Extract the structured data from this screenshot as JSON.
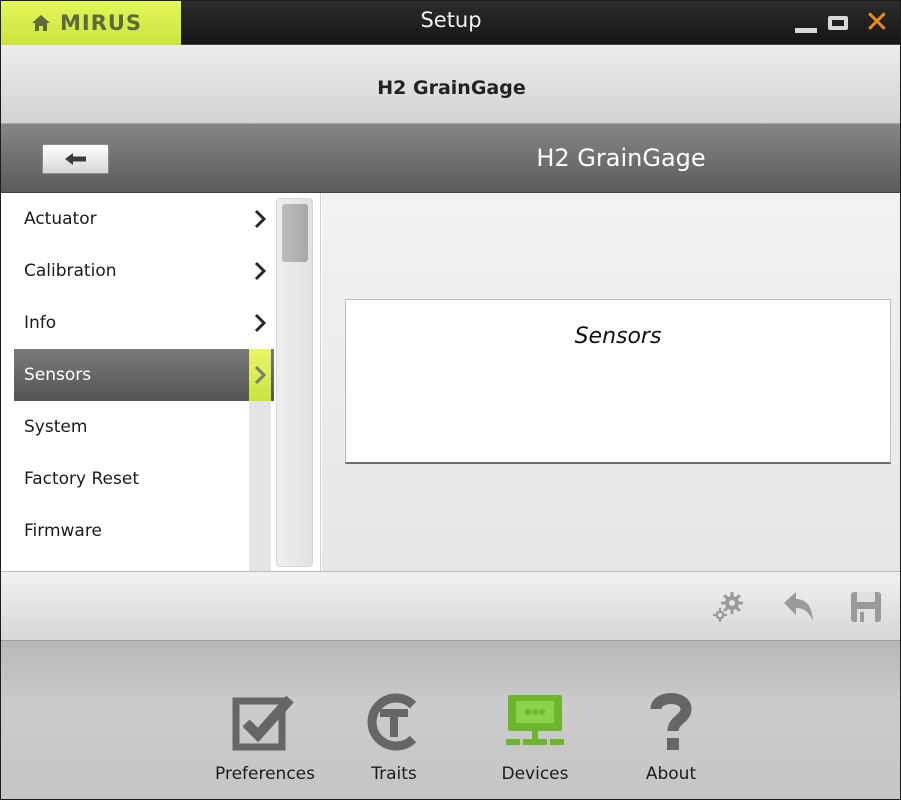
{
  "window": {
    "home_label": "MIRUS",
    "title": "Setup",
    "close_glyph": "✕",
    "accent_color": "#d4ea48",
    "close_color": "#f08a1c"
  },
  "subheader": {
    "title": "H2 GrainGage"
  },
  "pageheader": {
    "title": "H2 GrainGage",
    "back_icon": "back-arrow-icon"
  },
  "sidebar": {
    "items": [
      {
        "label": "Actuator",
        "has_chevron": true,
        "selected": false
      },
      {
        "label": "Calibration",
        "has_chevron": true,
        "selected": false
      },
      {
        "label": "Info",
        "has_chevron": true,
        "selected": false
      },
      {
        "label": "Sensors",
        "has_chevron": true,
        "selected": true
      },
      {
        "label": "System",
        "has_chevron": false,
        "selected": false
      },
      {
        "label": "Factory Reset",
        "has_chevron": false,
        "selected": false
      },
      {
        "label": "Firmware",
        "has_chevron": false,
        "selected": false
      }
    ]
  },
  "content": {
    "card_title": "Sensors"
  },
  "actionbar": {
    "icons": [
      "settings-gears-icon",
      "undo-arrow-icon",
      "save-disk-icon"
    ]
  },
  "bottomnav": {
    "items": [
      {
        "label": "Preferences",
        "icon": "checkbox-icon",
        "active": false
      },
      {
        "label": "Traits",
        "icon": "traits-t-icon",
        "active": false
      },
      {
        "label": "Devices",
        "icon": "devices-monitor-icon",
        "active": true
      },
      {
        "label": "About",
        "icon": "question-mark-icon",
        "active": false
      }
    ],
    "active_color": "#6cb52d"
  }
}
